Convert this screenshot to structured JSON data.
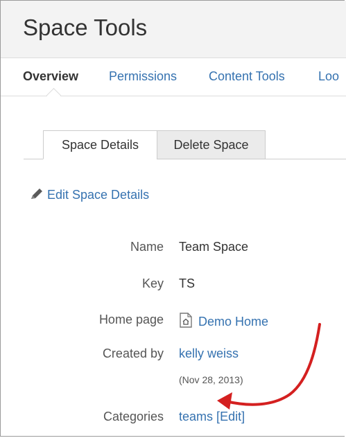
{
  "header": {
    "title": "Space Tools"
  },
  "nav": {
    "items": [
      {
        "label": "Overview",
        "active": true
      },
      {
        "label": "Permissions",
        "active": false
      },
      {
        "label": "Content Tools",
        "active": false
      },
      {
        "label": "Loo",
        "active": false
      }
    ]
  },
  "tabs": [
    {
      "label": "Space Details",
      "active": true
    },
    {
      "label": "Delete Space",
      "active": false
    }
  ],
  "edit_link": {
    "label": "Edit Space Details",
    "icon": "pencil-icon"
  },
  "details": {
    "name": {
      "label": "Name",
      "value": "Team Space"
    },
    "key": {
      "label": "Key",
      "value": "TS"
    },
    "home_page": {
      "label": "Home page",
      "value": "Demo Home",
      "icon": "page-home-icon"
    },
    "created_by": {
      "label": "Created by",
      "value": "kelly weiss",
      "date": "(Nov 28, 2013)"
    },
    "categories": {
      "label": "Categories",
      "value": "teams",
      "edit_open": "[",
      "edit_label": "Edit",
      "edit_close": "]"
    }
  },
  "colors": {
    "link": "#3572b0",
    "text": "#333333",
    "header_bg": "#f3f3f3",
    "annotation_arrow": "#d42020"
  }
}
